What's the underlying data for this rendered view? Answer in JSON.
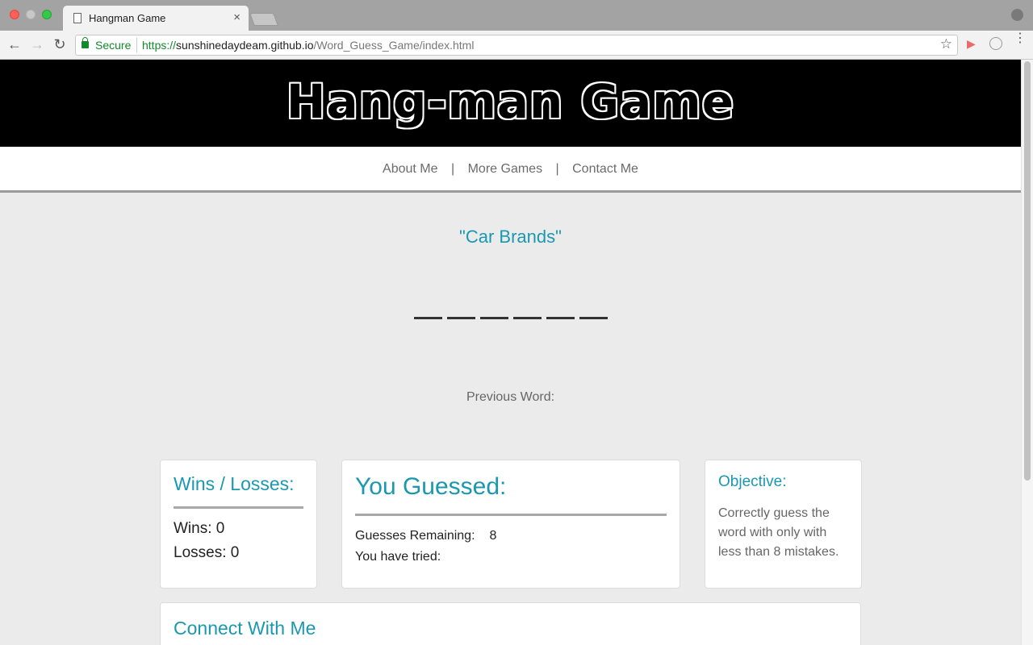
{
  "browser": {
    "tab_title": "Hangman Game",
    "tab_close": "×",
    "secure_label": "Secure",
    "url_scheme": "https://",
    "url_host": "sunshinedaydeam.github.io",
    "url_path": "/Word_Guess_Game/index.html",
    "back_glyph": "←",
    "forward_glyph": "→",
    "reload_glyph": "↻",
    "star_glyph": "☆",
    "menu_glyph": "⋮"
  },
  "header": {
    "title": "Hang-man Game"
  },
  "nav": {
    "items": [
      "About Me",
      "More Games",
      "Contact Me"
    ],
    "divider": "|"
  },
  "game": {
    "category": "\"Car Brands\"",
    "blank_count": 6,
    "previous_word_label": "Previous Word:"
  },
  "wins_losses": {
    "title": "Wins / Losses:",
    "wins": "Wins: 0",
    "losses": "Losses: 0"
  },
  "guessed": {
    "title": "You Guessed:",
    "remaining_label": "Guesses Remaining:",
    "remaining_value": "8",
    "tried_label": "You have tried:"
  },
  "objective": {
    "title": "Objective:",
    "text": "Correctly guess the word with only with less than 8 mistakes."
  },
  "connect": {
    "title": "Connect With Me"
  },
  "colors": {
    "accent": "#1a98b0",
    "header_bg": "#000000",
    "secure_green": "#128a2b"
  }
}
